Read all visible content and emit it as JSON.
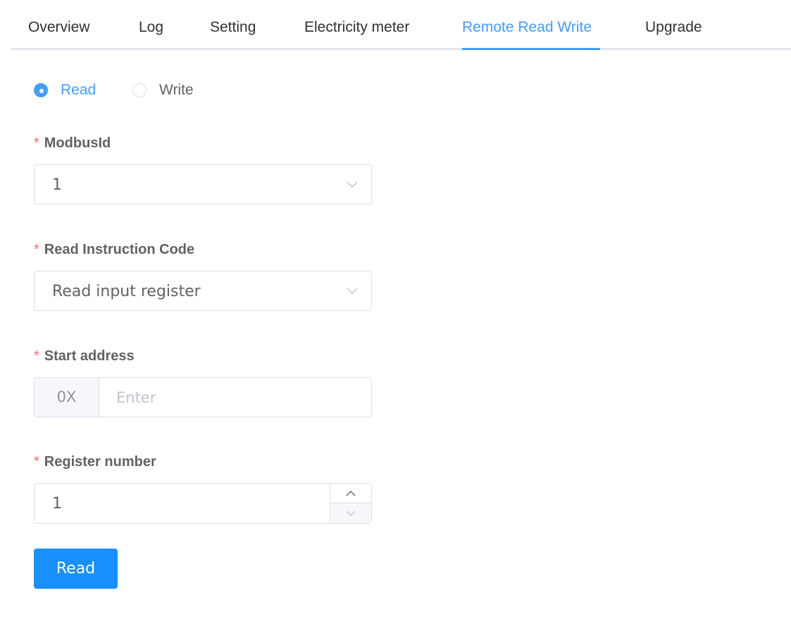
{
  "tabs": [
    {
      "label": "Overview"
    },
    {
      "label": "Log"
    },
    {
      "label": "Setting"
    },
    {
      "label": "Electricity meter"
    },
    {
      "label": "Remote Read Write"
    },
    {
      "label": "Upgrade"
    }
  ],
  "active_tab": "Remote Read Write",
  "mode": {
    "options": [
      {
        "label": "Read",
        "checked": true
      },
      {
        "label": "Write",
        "checked": false
      }
    ]
  },
  "form": {
    "required_mark": "*",
    "modbus_id": {
      "label": "ModbusId",
      "value": "1"
    },
    "instruction_code": {
      "label": "Read Instruction Code",
      "value": "Read input register"
    },
    "start_address": {
      "label": "Start address",
      "prefix": "0X",
      "placeholder": "Enter",
      "value": ""
    },
    "register_number": {
      "label": "Register number",
      "value": "1"
    }
  },
  "submit_label": "Read",
  "colors": {
    "accent": "#409eff",
    "button": "#1890ff",
    "required": "#f56c6c"
  },
  "icons": [
    "chevron-down-icon",
    "chevron-up-icon"
  ]
}
